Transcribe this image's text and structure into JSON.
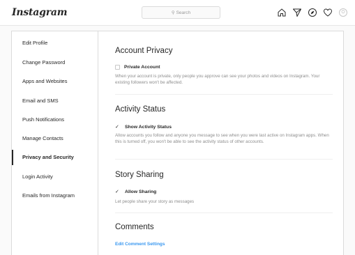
{
  "header": {
    "logo": "Instagram",
    "search_placeholder": "Search",
    "icons": [
      "home-icon",
      "direct-icon",
      "explore-icon",
      "heart-icon",
      "profile-icon"
    ]
  },
  "sidebar": {
    "items": [
      {
        "label": "Edit Profile",
        "active": false
      },
      {
        "label": "Change Password",
        "active": false
      },
      {
        "label": "Apps and Websites",
        "active": false
      },
      {
        "label": "Email and SMS",
        "active": false
      },
      {
        "label": "Push Notifications",
        "active": false
      },
      {
        "label": "Manage Contacts",
        "active": false
      },
      {
        "label": "Privacy and Security",
        "active": true
      },
      {
        "label": "Login Activity",
        "active": false
      },
      {
        "label": "Emails from Instagram",
        "active": false
      }
    ]
  },
  "account_privacy": {
    "title": "Account Privacy",
    "option_label": "Private Account",
    "checked": false,
    "description": "When your account is private, only people you approve can see your photos and videos on Instagram. Your existing followers won't be affected."
  },
  "activity_status": {
    "title": "Activity Status",
    "option_label": "Show Activity Status",
    "checked": true,
    "description": "Allow accounts you follow and anyone you message to see when you were last active on Instagram apps. When this is turned off, you won't be able to see the activity status of other accounts."
  },
  "story_sharing": {
    "title": "Story Sharing",
    "option_label": "Allow Sharing",
    "checked": true,
    "description": "Let people share your story as messages"
  },
  "comments": {
    "title": "Comments",
    "link_label": "Edit Comment Settings"
  },
  "colors": {
    "link": "#3897f0",
    "text": "#262626",
    "muted": "#8e8e8e",
    "border": "#dbdbdb"
  }
}
